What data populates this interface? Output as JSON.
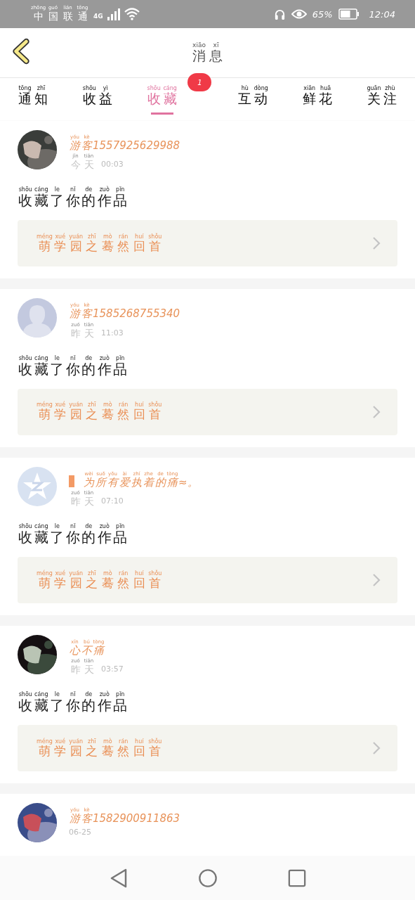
{
  "status_bar": {
    "carrier": {
      "text": "中国联通",
      "pinyin": [
        "zhōng",
        "guó",
        "lián",
        "tōng"
      ]
    },
    "network": "4G",
    "battery_percent": "65%",
    "time": "12:04"
  },
  "header": {
    "title": {
      "text": "消息",
      "pinyin": [
        "xiāo",
        "xī"
      ]
    }
  },
  "tabs": [
    {
      "text": "通知",
      "pinyin": [
        "tōng",
        "zhī"
      ],
      "selected": false
    },
    {
      "text": "收益",
      "pinyin": [
        "shōu",
        "yì"
      ],
      "selected": false
    },
    {
      "text": "收藏",
      "pinyin": [
        "shōu",
        "cáng"
      ],
      "selected": true,
      "badge": "1"
    },
    {
      "text": "互动",
      "pinyin": [
        "hù",
        "dòng"
      ],
      "selected": false
    },
    {
      "text": "鲜花",
      "pinyin": [
        "xiān",
        "huā"
      ],
      "selected": false
    },
    {
      "text": "关注",
      "pinyin": [
        "guān",
        "zhù"
      ],
      "selected": false
    }
  ],
  "messages": [
    {
      "name": {
        "text": "游客1557925629988",
        "pinyin": [
          "yóu",
          "kè"
        ]
      },
      "name_mark": false,
      "day": {
        "text": "今天",
        "pinyin": [
          "jīn",
          "tiān"
        ]
      },
      "time": "00:03",
      "action": {
        "text": "收藏了你的作品",
        "pinyin": [
          "shōu",
          "cáng",
          "le",
          "nǐ",
          "de",
          "zuò",
          "pǐn"
        ]
      },
      "work": {
        "text": "萌学园之蓦然回首",
        "pinyin": [
          "méng",
          "xué",
          "yuán",
          "zhī",
          "mò",
          "rán",
          "huí",
          "shǒu"
        ]
      }
    },
    {
      "avatar": {
        "kind": "default"
      },
      "name": {
        "text": "游客1585268755340",
        "pinyin": [
          "yóu",
          "kè"
        ]
      },
      "name_mark": false,
      "day": {
        "text": "昨天",
        "pinyin": [
          "zuó",
          "tiān"
        ]
      },
      "time": "11:03",
      "action": {
        "text": "收藏了你的作品",
        "pinyin": [
          "shōu",
          "cáng",
          "le",
          "nǐ",
          "de",
          "zuò",
          "pǐn"
        ]
      },
      "work": {
        "text": "萌学园之蓦然回首",
        "pinyin": [
          "méng",
          "xué",
          "yuán",
          "zhī",
          "mò",
          "rán",
          "huí",
          "shǒu"
        ]
      }
    },
    {
      "avatar": {
        "kind": "star"
      },
      "name": {
        "text": "为所有爱执着的痛≈。",
        "pinyin": [
          "wèi",
          "suǒ",
          "yǒu",
          "ài",
          "zhí",
          "zhe",
          "de",
          "tòng"
        ]
      },
      "name_mark": true,
      "day": {
        "text": "昨天",
        "pinyin": [
          "zuó",
          "tiān"
        ]
      },
      "time": "07:10",
      "action": {
        "text": "收藏了你的作品",
        "pinyin": [
          "shōu",
          "cáng",
          "le",
          "nǐ",
          "de",
          "zuò",
          "pǐn"
        ]
      },
      "work": {
        "text": "萌学园之蓦然回首",
        "pinyin": [
          "méng",
          "xué",
          "yuán",
          "zhī",
          "mò",
          "rán",
          "huí",
          "shǒu"
        ]
      }
    },
    {
      "name": {
        "text": "心不痛",
        "pinyin": [
          "xīn",
          "bú",
          "tòng"
        ]
      },
      "name_mark": false,
      "day": {
        "text": "昨天",
        "pinyin": [
          "zuó",
          "tiān"
        ]
      },
      "time": "03:57",
      "action": {
        "text": "收藏了你的作品",
        "pinyin": [
          "shōu",
          "cáng",
          "le",
          "nǐ",
          "de",
          "zuò",
          "pǐn"
        ]
      },
      "work": {
        "text": "萌学园之蓦然回首",
        "pinyin": [
          "méng",
          "xué",
          "yuán",
          "zhī",
          "mò",
          "rán",
          "huí",
          "shǒu"
        ]
      }
    },
    {
      "name": {
        "text": "游客1582900911863",
        "pinyin": [
          "yóu",
          "kè"
        ]
      },
      "name_mark": false,
      "time": "06-25"
    }
  ]
}
